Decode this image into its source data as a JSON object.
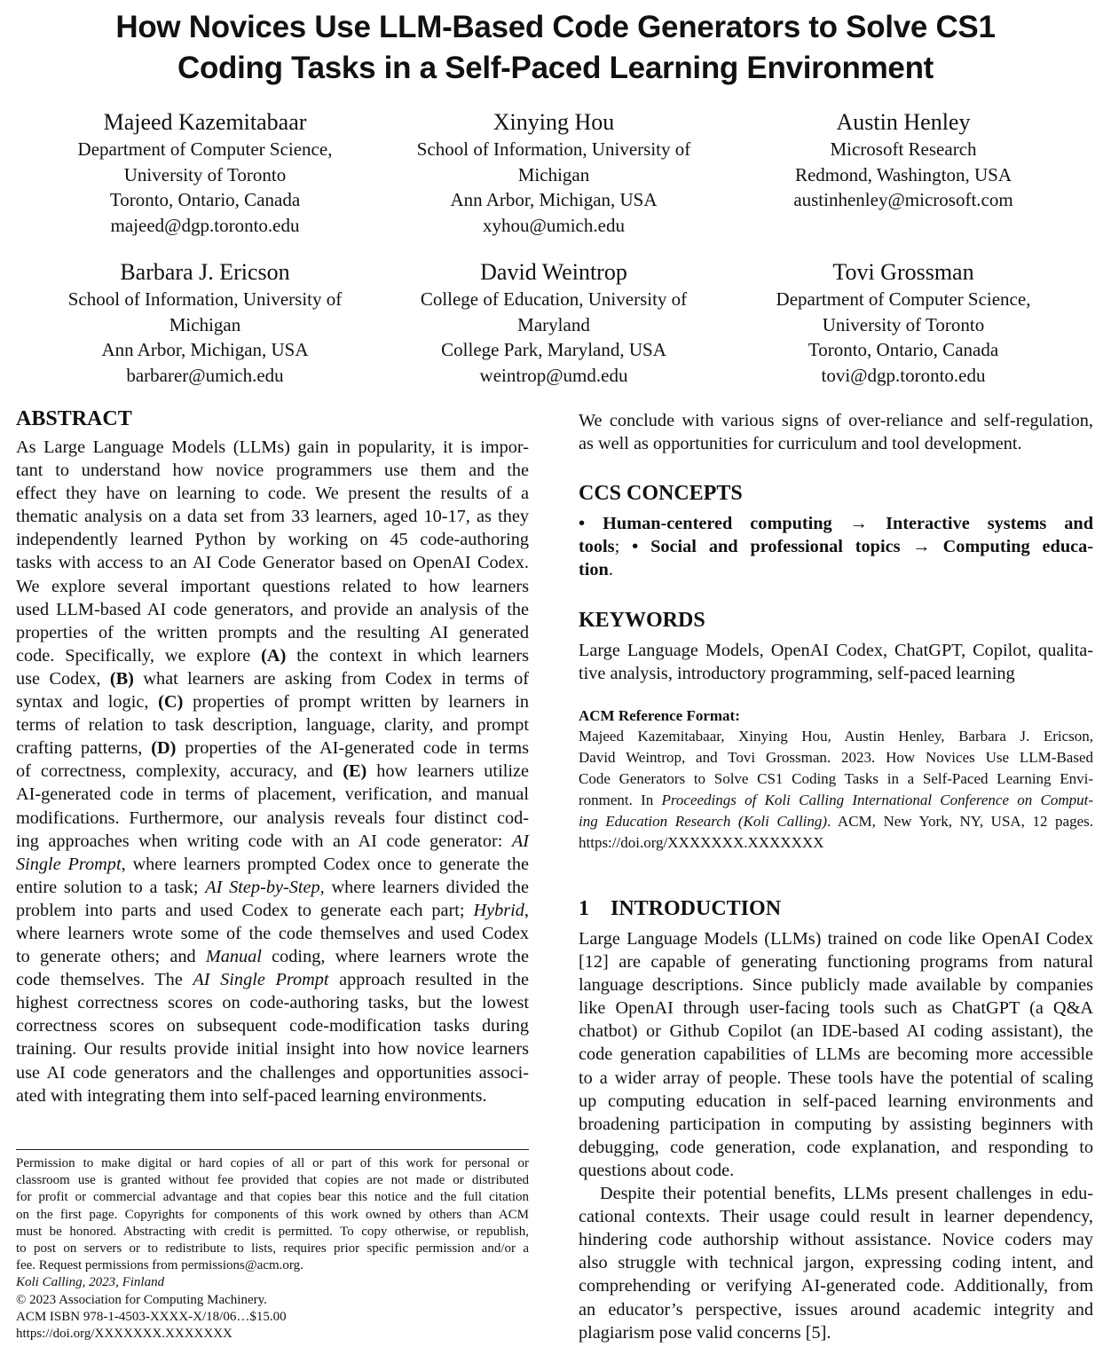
{
  "title": {
    "line1": "How Novices Use LLM-Based Code Generators to Solve CS1",
    "line2": "Coding Tasks in a Self-Paced Learning Environment"
  },
  "authors": [
    {
      "name": "Majeed Kazemitabaar",
      "lines": [
        "Department of Computer Science,",
        "University of Toronto",
        "Toronto, Ontario, Canada",
        "majeed@dgp.toronto.edu"
      ]
    },
    {
      "name": "Xinying Hou",
      "lines": [
        "School of Information, University of",
        "Michigan",
        "Ann Arbor, Michigan, USA",
        "xyhou@umich.edu"
      ]
    },
    {
      "name": "Austin Henley",
      "lines": [
        "Microsoft Research",
        "Redmond, Washington, USA",
        "austinhenley@microsoft.com",
        ""
      ]
    },
    {
      "name": "Barbara J. Ericson",
      "lines": [
        "School of Information, University of",
        "Michigan",
        "Ann Arbor, Michigan, USA",
        "barbarer@umich.edu"
      ]
    },
    {
      "name": "David Weintrop",
      "lines": [
        "College of Education, University of",
        "Maryland",
        "College Park, Maryland, USA",
        "weintrop@umd.edu"
      ]
    },
    {
      "name": "Tovi Grossman",
      "lines": [
        "Department of Computer Science,",
        "University of Toronto",
        "Toronto, Ontario, Canada",
        "tovi@dgp.toronto.edu"
      ]
    }
  ],
  "abstract": {
    "heading": "ABSTRACT",
    "lines": [
      "As Large Language Models (LLMs) gain in popularity, it is impor-",
      "tant to understand how novice programmers use them and the",
      "effect they have on learning to code. We present the results of a",
      "thematic analysis on a data set from 33 learners, aged 10-17, as they",
      "independently learned Python by working on 45 code-authoring",
      "tasks with access to an AI Code Generator based on OpenAI Codex.",
      "We explore several important questions related to how learners",
      "used LLM-based AI code generators, and provide an analysis of the",
      "properties of the written prompts and the resulting AI generated",
      [
        "code. Specifically, we explore ",
        {
          "b": "(A)"
        },
        " the context in which learners"
      ],
      [
        "use Codex, ",
        {
          "b": "(B)"
        },
        " what learners are asking from Codex in terms of"
      ],
      [
        "syntax and logic, ",
        {
          "b": "(C)"
        },
        " properties of prompt written by learners in"
      ],
      "terms of relation to task description, language, clarity, and prompt",
      [
        "crafting patterns, ",
        {
          "b": "(D)"
        },
        " properties of the AI-generated code in terms"
      ],
      [
        "of correctness, complexity, accuracy, and ",
        {
          "b": "(E)"
        },
        " how learners utilize"
      ],
      "AI-generated code in terms of placement, verification, and manual",
      "modifications. Furthermore, our analysis reveals four distinct cod-",
      [
        "ing approaches when writing code with an AI code generator: ",
        {
          "i": "AI"
        }
      ],
      [
        {
          "i": "Single Prompt"
        },
        ", where learners prompted Codex once to generate the"
      ],
      [
        "entire solution to a task; ",
        {
          "i": "AI Step-by-Step"
        },
        ", where learners divided the"
      ],
      [
        "problem into parts and used Codex to generate each part; ",
        {
          "i": "Hybrid"
        },
        ","
      ],
      "where learners wrote some of the code themselves and used Codex",
      [
        "to generate others; and ",
        {
          "i": "Manual"
        },
        " coding, where learners wrote the"
      ],
      [
        "code themselves. The ",
        {
          "i": "AI Single Prompt"
        },
        " approach resulted in the"
      ],
      "highest correctness scores on code-authoring tasks, but the lowest",
      "correctness scores on subsequent code-modification tasks during",
      "training. Our results provide initial insight into how novice learners",
      "use AI code generators and the challenges and opportunities associ-",
      "ated with integrating them into self-paced learning environments."
    ],
    "continuation": [
      "We conclude with various signs of over-reliance and self-regulation,",
      "as well as opportunities for curriculum and tool development."
    ]
  },
  "permission": {
    "lines": [
      "Permission to make digital or hard copies of all or part of this work for personal or",
      "classroom use is granted without fee provided that copies are not made or distributed",
      "for profit or commercial advantage and that copies bear this notice and the full citation",
      "on the first page. Copyrights for components of this work owned by others than ACM",
      "must be honored. Abstracting with credit is permitted. To copy otherwise, or republish,",
      "to post on servers or to redistribute to lists, requires prior specific permission and/or a",
      "fee. Request permissions from permissions@acm.org."
    ],
    "venue": "Koli Calling, 2023, Finland",
    "copyright": "© 2023 Association for Computing Machinery.",
    "isbn": "ACM ISBN 978-1-4503-XXXX-X/18/06…$15.00",
    "doi": "https://doi.org/XXXXXXX.XXXXXXX"
  },
  "ccs": {
    "heading": "CCS CONCEPTS",
    "lines": [
      [
        {
          "b": "• Human-centered computing → Interactive systems and"
        }
      ],
      [
        {
          "b": "tools"
        },
        "; ",
        {
          "b": "• Social and professional topics → Computing educa-"
        }
      ],
      [
        {
          "b": "tion"
        },
        "."
      ]
    ]
  },
  "keywords": {
    "heading": "KEYWORDS",
    "lines": [
      "Large Language Models, OpenAI Codex, ChatGPT, Copilot, qualita-",
      "tive analysis, introductory programming, self-paced learning"
    ]
  },
  "reference": {
    "heading": "ACM Reference Format:",
    "lines": [
      "Majeed Kazemitabaar, Xinying Hou, Austin Henley, Barbara J. Ericson,",
      "David Weintrop, and Tovi Grossman. 2023. How Novices Use LLM-Based",
      "Code Generators to Solve CS1 Coding Tasks in a Self-Paced Learning Envi-",
      [
        "ronment. In ",
        {
          "i": "Proceedings of Koli Calling International Conference on Comput-"
        }
      ],
      [
        {
          "i": "ing Education Research (Koli Calling)"
        },
        ". ACM, New York, NY, USA, 12 pages."
      ],
      "https://doi.org/XXXXXXX.XXXXXXX"
    ]
  },
  "introduction": {
    "number": "1",
    "heading": "INTRODUCTION",
    "lines": [
      "Large Language Models (LLMs) trained on code like OpenAI Codex",
      "[12] are capable of generating functioning programs from natural",
      "language descriptions. Since publicly made available by companies",
      "like OpenAI through user-facing tools such as ChatGPT (a Q&A",
      "chatbot) or Github Copilot (an IDE-based AI coding assistant), the",
      "code generation capabilities of LLMs are becoming more accessible",
      "to a wider array of people. These tools have the potential of scaling",
      "up computing education in self-paced learning environments and",
      "broadening participation in computing by assisting beginners with",
      "debugging, code generation, code explanation, and responding to",
      "questions about code.",
      "Despite their potential benefits, LLMs present challenges in edu-",
      "cational contexts. Their usage could result in learner dependency,",
      "hindering code authorship without assistance. Novice coders may",
      "also struggle with technical jargon, expressing coding intent, and",
      "comprehending or verifying AI-generated code. Additionally, from",
      "an educator’s perspective, issues around academic integrity and",
      "plagiarism pose valid concerns [5]."
    ]
  }
}
